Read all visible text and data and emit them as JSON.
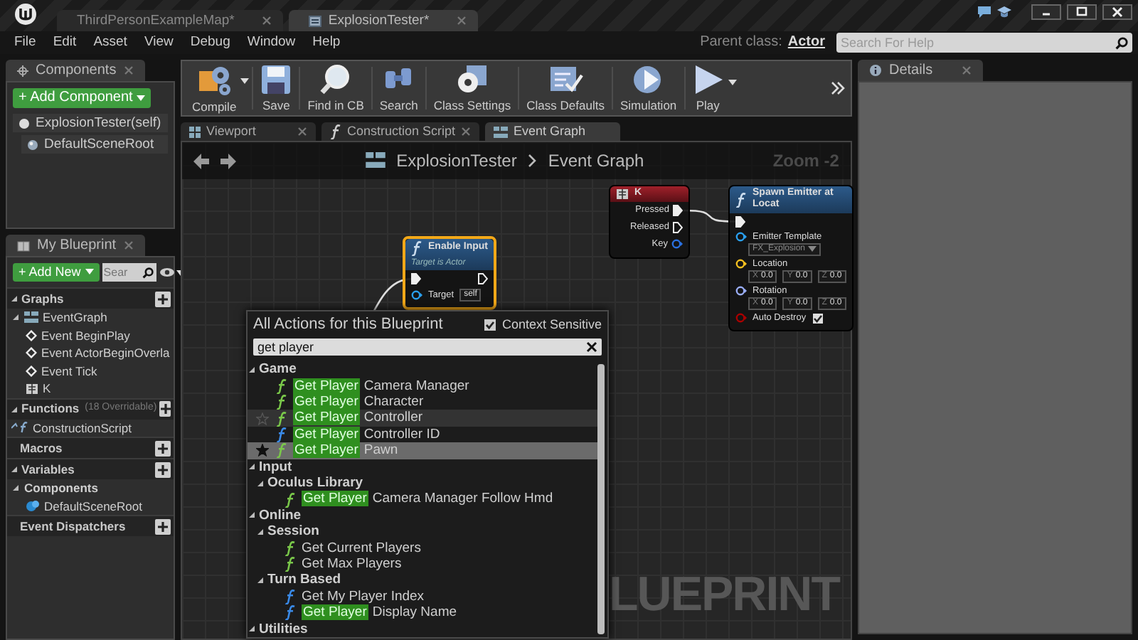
{
  "title_bar": {
    "tabs": [
      {
        "label": "ThirdPersonExampleMap*",
        "kind": "level",
        "selected": false
      },
      {
        "label": "ExplosionTester*",
        "kind": "blueprint",
        "selected": true
      }
    ]
  },
  "menu_bar": {
    "items": [
      "File",
      "Edit",
      "Asset",
      "View",
      "Debug",
      "Window",
      "Help"
    ],
    "parent_class_label": "Parent class:",
    "parent_class": "Actor",
    "help_search": {
      "placeholder": "Search For Help"
    }
  },
  "components_panel": {
    "tab": "Components",
    "add_button": "+ Add Component",
    "items": [
      {
        "label": "ExplosionTester(self)",
        "kind": "self"
      },
      {
        "label": "DefaultSceneRoot",
        "kind": "scene"
      }
    ]
  },
  "my_blueprint": {
    "tab": "My Blueprint",
    "add_button": "+ Add New",
    "search": {
      "placeholder": "Sear"
    },
    "sections": [
      {
        "label": "Graphs",
        "expanded": true,
        "addable": true,
        "items": [
          {
            "label": "EventGraph",
            "kind": "graph",
            "expanded": true,
            "children": [
              {
                "label": "Event BeginPlay",
                "kind": "event"
              },
              {
                "label": "Event ActorBeginOverla",
                "kind": "event"
              },
              {
                "label": "Event Tick",
                "kind": "event"
              },
              {
                "label": "K",
                "kind": "key"
              }
            ]
          }
        ]
      },
      {
        "label": "Functions",
        "note": "(18 Overridable)",
        "expanded": true,
        "addable": true,
        "items": [
          {
            "label": "ConstructionScript",
            "kind": "function"
          }
        ]
      },
      {
        "label": "Macros",
        "addable": true
      },
      {
        "label": "Variables",
        "expanded": true,
        "addable": true,
        "items": [
          {
            "label": "Components",
            "kind": "category",
            "expanded": true,
            "children": [
              {
                "label": "DefaultSceneRoot",
                "kind": "component"
              }
            ]
          }
        ]
      },
      {
        "label": "Event Dispatchers",
        "addable": true
      }
    ]
  },
  "toolbar": {
    "buttons": [
      {
        "label": "Compile",
        "kind": "compile",
        "dropdown": true
      },
      {
        "label": "Save",
        "kind": "save",
        "dropdown": false
      },
      {
        "label": "Find in CB",
        "kind": "find",
        "dropdown": false
      },
      {
        "label": "Search",
        "kind": "search",
        "dropdown": false
      },
      {
        "label": "Class Settings",
        "kind": "settings",
        "dropdown": false
      },
      {
        "label": "Class Defaults",
        "kind": "defaults",
        "dropdown": false
      },
      {
        "label": "Simulation",
        "kind": "simulate",
        "dropdown": false
      },
      {
        "label": "Play",
        "kind": "play",
        "dropdown": true
      }
    ]
  },
  "editor_tabs": [
    {
      "label": "Viewport",
      "kind": "viewport",
      "selected": false
    },
    {
      "label": "Construction Script",
      "kind": "function",
      "selected": false
    },
    {
      "label": "Event Graph",
      "kind": "graph",
      "selected": true
    }
  ],
  "graph": {
    "breadcrumb": [
      "ExplosionTester",
      "Event Graph"
    ],
    "zoom": "Zoom -2",
    "graph_type_label": "LUEPRINT",
    "nodes": [
      {
        "kind": "function",
        "title": "Enable Input",
        "subtitle": "Target is Actor",
        "selected": true,
        "exec_in_connected": true,
        "exec_out_connected": false,
        "inputs": [
          {
            "label": "Target",
            "kind": "object",
            "default": "self"
          }
        ]
      },
      {
        "kind": "event",
        "title": "K",
        "selected": false,
        "outputs": [
          {
            "label": "Pressed",
            "kind": "exec",
            "connected": true
          },
          {
            "label": "Released",
            "kind": "exec",
            "connected": false
          },
          {
            "label": "Key",
            "kind": "struct",
            "connected": false
          }
        ]
      },
      {
        "kind": "function",
        "title": "Spawn Emitter at Locat",
        "selected": false,
        "exec_in_connected": true,
        "inputs": [
          {
            "label": "Emitter Template",
            "kind": "object",
            "asset": "FX_Explosion"
          },
          {
            "label": "Location",
            "kind": "vector",
            "components": [
              {
                "axis": "X",
                "value": "0.0"
              },
              {
                "axis": "Y",
                "value": "0.0"
              },
              {
                "axis": "Z",
                "value": "0.0"
              }
            ]
          },
          {
            "label": "Rotation",
            "kind": "rotator",
            "components": [
              {
                "axis": "X",
                "value": "0.0"
              },
              {
                "axis": "Y",
                "value": "0.0"
              },
              {
                "axis": "Z",
                "value": "0.0"
              }
            ]
          },
          {
            "label": "Auto Destroy",
            "kind": "bool",
            "checked": true
          }
        ]
      }
    ],
    "action_menu": {
      "title": "All Actions for this Blueprint",
      "context_sensitive": {
        "label": "Context Sensitive",
        "checked": true
      },
      "search": {
        "value": "get player"
      },
      "tree": [
        {
          "kind": "category",
          "label": "Game",
          "expanded": true,
          "children": [
            {
              "kind": "action",
              "pure": true,
              "hovered": false,
              "selected": false,
              "parts": [
                {
                  "text": "Get Player",
                  "match": true
                },
                {
                  "text": "Camera Manager",
                  "match": false
                }
              ]
            },
            {
              "kind": "action",
              "pure": true,
              "hovered": false,
              "selected": false,
              "parts": [
                {
                  "text": "Get Player",
                  "match": true
                },
                {
                  "text": "Character",
                  "match": false
                }
              ]
            },
            {
              "kind": "action",
              "pure": true,
              "hovered": true,
              "selected": false,
              "parts": [
                {
                  "text": "Get Player",
                  "match": true
                },
                {
                  "text": "Controller",
                  "match": false
                }
              ]
            },
            {
              "kind": "action",
              "pure": false,
              "hovered": false,
              "selected": false,
              "parts": [
                {
                  "text": "Get Player",
                  "match": true
                },
                {
                  "text": "Controller ID",
                  "match": false
                }
              ]
            },
            {
              "kind": "action",
              "pure": true,
              "hovered": false,
              "selected": true,
              "parts": [
                {
                  "text": "Get Player",
                  "match": true
                },
                {
                  "text": "Pawn",
                  "match": false
                }
              ]
            }
          ]
        },
        {
          "kind": "category",
          "label": "Input",
          "expanded": true,
          "children": [
            {
              "kind": "category",
              "label": "Oculus Library",
              "expanded": true,
              "children": [
                {
                  "kind": "action",
                  "pure": true,
                  "hovered": false,
                  "selected": false,
                  "parts": [
                    {
                      "text": "Get Player",
                      "match": true
                    },
                    {
                      "text": "Camera Manager Follow Hmd",
                      "match": false
                    }
                  ]
                }
              ]
            }
          ]
        },
        {
          "kind": "category",
          "label": "Online",
          "expanded": true,
          "children": [
            {
              "kind": "category",
              "label": "Session",
              "expanded": true,
              "children": [
                {
                  "kind": "action",
                  "pure": true,
                  "hovered": false,
                  "selected": false,
                  "parts": [
                    {
                      "text": "Get Current Players",
                      "match": false
                    }
                  ]
                },
                {
                  "kind": "action",
                  "pure": true,
                  "hovered": false,
                  "selected": false,
                  "parts": [
                    {
                      "text": "Get Max Players",
                      "match": false
                    }
                  ]
                }
              ]
            },
            {
              "kind": "category",
              "label": "Turn Based",
              "expanded": true,
              "children": [
                {
                  "kind": "action",
                  "pure": false,
                  "hovered": false,
                  "selected": false,
                  "parts": [
                    {
                      "text": "Get My Player Index",
                      "match": false
                    }
                  ]
                },
                {
                  "kind": "action",
                  "pure": false,
                  "hovered": false,
                  "selected": false,
                  "parts": [
                    {
                      "text": "Get Player",
                      "match": true
                    },
                    {
                      "text": "Display Name",
                      "match": false
                    }
                  ]
                }
              ]
            }
          ]
        },
        {
          "kind": "category",
          "label": "Utilities",
          "expanded": true
        }
      ]
    }
  },
  "details_panel": {
    "tab": "Details"
  }
}
